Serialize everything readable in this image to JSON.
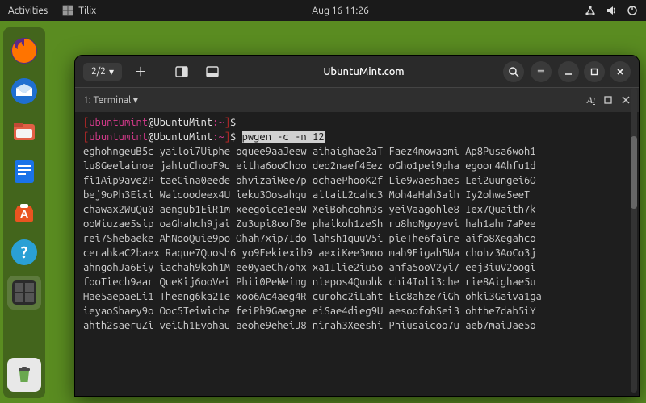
{
  "topbar": {
    "activities": "Activities",
    "app": "Tilix",
    "clock": "Aug 16  11:26"
  },
  "dock": {
    "items": [
      {
        "name": "firefox",
        "color": "#ff7400",
        "glyph": "firefox"
      },
      {
        "name": "thunderbird",
        "color": "#1f6fd0",
        "glyph": "thunderbird"
      },
      {
        "name": "files",
        "color": "#e25f45",
        "glyph": "files"
      },
      {
        "name": "libreoffice",
        "color": "#1a73e8",
        "glyph": "writer"
      },
      {
        "name": "software",
        "color": "#e95420",
        "glyph": "software"
      },
      {
        "name": "help",
        "color": "#2aa0d5",
        "glyph": "help"
      },
      {
        "name": "tilix",
        "color": "#2b2b2b",
        "glyph": "terminal",
        "active": true
      }
    ]
  },
  "window": {
    "tabcount": "2/2",
    "title": "UbuntuMint.com",
    "tab_label": "1: Terminal"
  },
  "terminal": {
    "prompt": {
      "user": "ubuntumint",
      "host": "UbuntuMint",
      "path": "~",
      "sym": "$"
    },
    "command": "pwgen -c -n 12",
    "output_lines": [
      "eghohngeuB5c yailoi7Uiphe oquee9aaJeew aihaighae2aT Faez4mowaomi Ap8Pusa6woh1",
      "lu8Geelainoe jahtuChooF9u eitha6ooChoo deo2naef4Eez oGho1pei9pha egoor4Ahfu1d",
      "fi1Aip9ave2P taeCina0eede ohvizaiWee7p ochaePhooK2f Lie9waeshaes Lei2uungei6O",
      "bej9oPh3Eixi Waicoodeex4U ieku3Oosahqu aitaiL2cahc3 Moh4aHah3aih Iy2ohwa5eeT",
      "chawax2WuQu0 aengub1EiR1m xeegoice1eeW XeiBohcohm3s yeiVaagohle8 Iex7Quaith7k",
      "ooWiuzae5sip oaGhahch9jai Zu3upi8oof0e phaikoh1zeSh ru8hoNgoyevi hah1ahr7aPee",
      "rei7Shebaeke AhNooQuie9po Ohah7xip7Ido lahsh1quuV5i pieThe6faire aifo8Xegahco",
      "cerahkaC2baex Raque7Quosh6 yo9Eekiexib9 aexiKee3moo mah9Eigah5Wa chohz3AoCo3j",
      "ahngohJa6Eiy iachah9koh1M ee0yaeCh7ohx xa1Ilie2iu5o ahfa5ooV2yi7 eej3iuV2oogi",
      "fooTiech9aar QueKij6ooVei Phii0PeWeing niepos4Quohk chi4Ioli3che rie8Aighae5u",
      "Hae5aepaeLi1 Theeng6ka2Ie xoo6Ac4aeg4R curohc2iLaht Eic8ahze7iGh ohki3Gaiva1ga",
      "ieyaoShaey9o Ooc5Teiwicha feiPh9Gaegae eiSae4dieg9U aesoofohSei3 ohthe7dah5iY",
      "ahth2saeruZi veiGh1Evohau aeohe9eheiJ8 nirah3Xeeshi Phiusaicoo7u aeb7maiJae5o"
    ]
  }
}
